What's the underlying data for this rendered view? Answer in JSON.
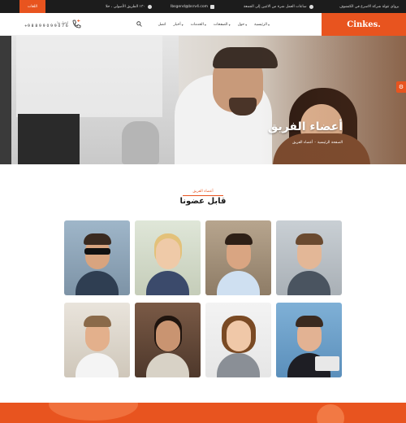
{
  "topbar": {
    "lang_label": "اللغات",
    "notice": "برواي تتولة شركة الاسرع في الكنشوف",
    "hours": "ساعات العمل شرة من الاثنين إلى الجمعة",
    "email": "Ibsgend@bsrv4.com",
    "address": "١٣٠ الطريق الأصولي ، حلا"
  },
  "header": {
    "logo": "Cinkes.",
    "phone_label": "اتصل بنا",
    "phone_number": "+9 8 8 9 9 0 9 9 0 7 6",
    "nav": [
      {
        "label": "الرئيسية",
        "has_dropdown": true
      },
      {
        "label": "حول",
        "has_dropdown": true
      },
      {
        "label": "الصفحات",
        "has_dropdown": true
      },
      {
        "label": "الخدمات",
        "has_dropdown": true
      },
      {
        "label": "أخبار",
        "has_dropdown": true
      },
      {
        "label": "اتصل",
        "has_dropdown": false
      }
    ]
  },
  "hero": {
    "title": "أعضاء الفريق",
    "breadcrumb_home": "الصفحة الرئيسية",
    "breadcrumb_sep": "-",
    "breadcrumb_current": "أعضاء الفريق"
  },
  "team": {
    "tag": "أعضاء الفريق",
    "title": "قابل عضونا"
  },
  "colors": {
    "accent": "#e8541f",
    "topbar_bg": "#1c1c1c"
  }
}
